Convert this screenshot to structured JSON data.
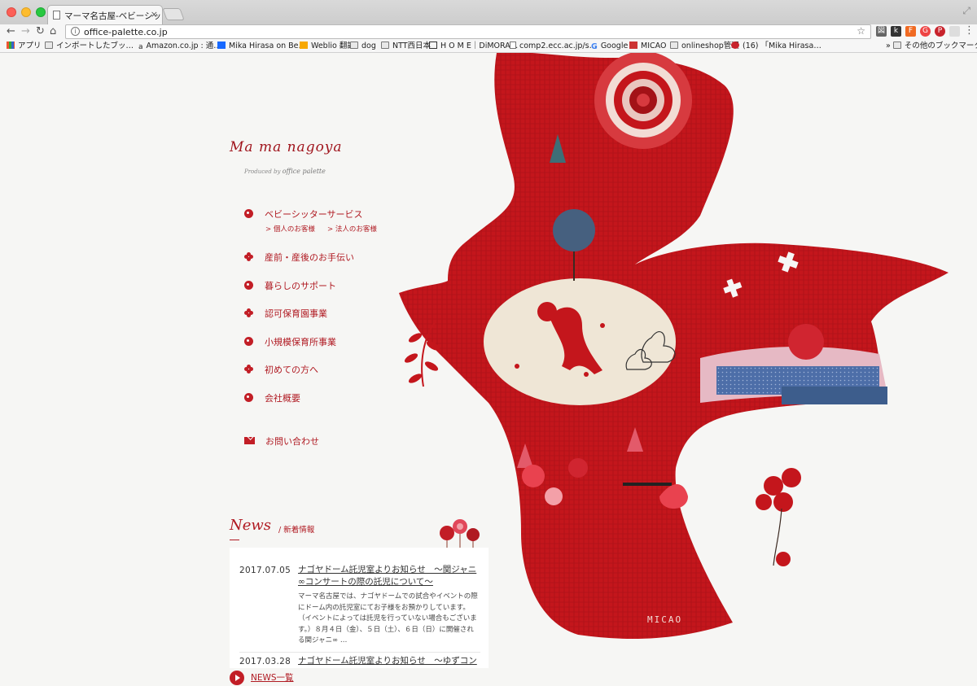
{
  "browser": {
    "tab_title": "マーマ名古屋-ベビーシッター",
    "tab_close": "×",
    "url": "office-palette.co.jp",
    "bookmarks": [
      {
        "label": "アプリ"
      },
      {
        "label": "インポートしたブッ…"
      },
      {
        "label": "Amazon.co.jp : 通…"
      },
      {
        "label": "Mika Hirasa on Be…"
      },
      {
        "label": "Weblio 翻訳"
      },
      {
        "label": "dog"
      },
      {
        "label": "NTT西日本"
      },
      {
        "label": "H O M E｜DiMORA…"
      },
      {
        "label": "comp2.ecc.ac.jp/s…"
      },
      {
        "label": "Google"
      },
      {
        "label": "MICAO"
      },
      {
        "label": "onlineshop管理"
      },
      {
        "label": "(16) 「Mika Hirasa…"
      },
      {
        "label": "その他のブックマーク"
      }
    ]
  },
  "logo": {
    "script": "Ma ma nagoya",
    "produced_by": "Produced by",
    "company": "office palette"
  },
  "menu": {
    "babysitter": "ベビーシッターサービス",
    "individual": "> 個人のお客様",
    "corporate": "> 法人のお客様",
    "childbirth": "産前・産後のお手伝い",
    "living": "暮らしのサポート",
    "licensed": "認可保育園事業",
    "small": "小規模保育所事業",
    "first_time": "初めての方へ",
    "company": "会社概要",
    "contact": "お問い合わせ"
  },
  "news": {
    "heading": "News",
    "subheading": "/ 新着情報",
    "items": [
      {
        "date": "2017.07.05",
        "title": "ナゴヤドーム託児室よりお知らせ　〜関ジャニ∞コンサートの際の託児について〜",
        "body": "マーマ名古屋では、ナゴヤドームでの試合やイベントの際にドーム内の託児室にてお子様をお預かりしています。（イベントによっては託児を行っていない場合もございます。）８月４日（金）、５日（土）、６日（日）に開催される関ジャニ∞ …"
      },
      {
        "date": "2017.03.28",
        "title": "ナゴヤドーム託児室よりお知らせ　〜ゆずコン"
      }
    ],
    "list_link": "NEWS一覧"
  },
  "artwork": {
    "signature": "MICAO"
  },
  "colors": {
    "brand_red": "#b01a22",
    "bird_red": "#c4161c"
  }
}
